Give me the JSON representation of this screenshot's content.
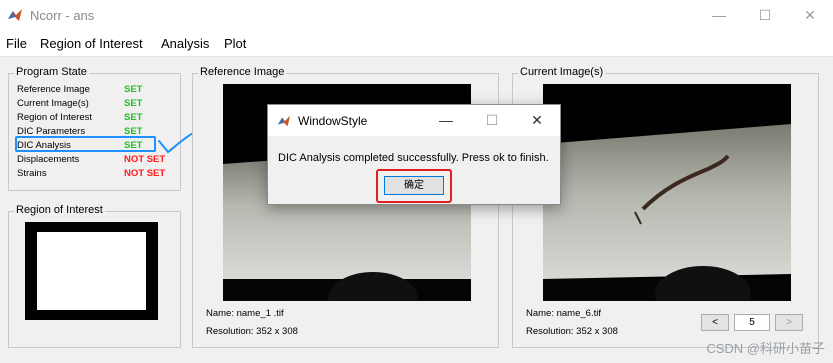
{
  "window": {
    "title": "Ncorr - ans",
    "minimize_glyph": "—",
    "maximize_glyph": "☐",
    "close_glyph": "✕"
  },
  "menu": [
    "File",
    "Region of Interest",
    "Analysis",
    "Plot"
  ],
  "program_state": {
    "title": "Program State",
    "rows": [
      {
        "label": "Reference Image",
        "value": "SET"
      },
      {
        "label": "Current Image(s)",
        "value": "SET"
      },
      {
        "label": "Region of Interest",
        "value": "SET"
      },
      {
        "label": "DIC Parameters",
        "value": "SET"
      },
      {
        "label": "DIC Analysis",
        "value": "SET"
      },
      {
        "label": "Displacements",
        "value": "NOT SET"
      },
      {
        "label": "Strains",
        "value": "NOT SET"
      }
    ],
    "set_color": "#22c022",
    "not_set_color": "#ff1a1a"
  },
  "roi": {
    "title": "Region of Interest"
  },
  "reference": {
    "title": "Reference Image",
    "name": "Name: name_1 .tif",
    "resolution": "Resolution: 352 x 308"
  },
  "current": {
    "title": "Current Image(s)",
    "name": "Name: name_6.tif",
    "resolution": "Resolution: 352 x 308",
    "prev_label": "<",
    "next_label": ">",
    "frame": "5"
  },
  "dialog": {
    "title": "WindowStyle",
    "message": "DIC Analysis completed successfully. Press ok to finish.",
    "ok_label": "确定",
    "minimize_glyph": "—",
    "maximize_glyph": "☐",
    "close_glyph": "✕"
  },
  "watermark": "CSDN @科研小苗子",
  "annotation_color": "#1e90ff",
  "highlight_color": "#e02020"
}
